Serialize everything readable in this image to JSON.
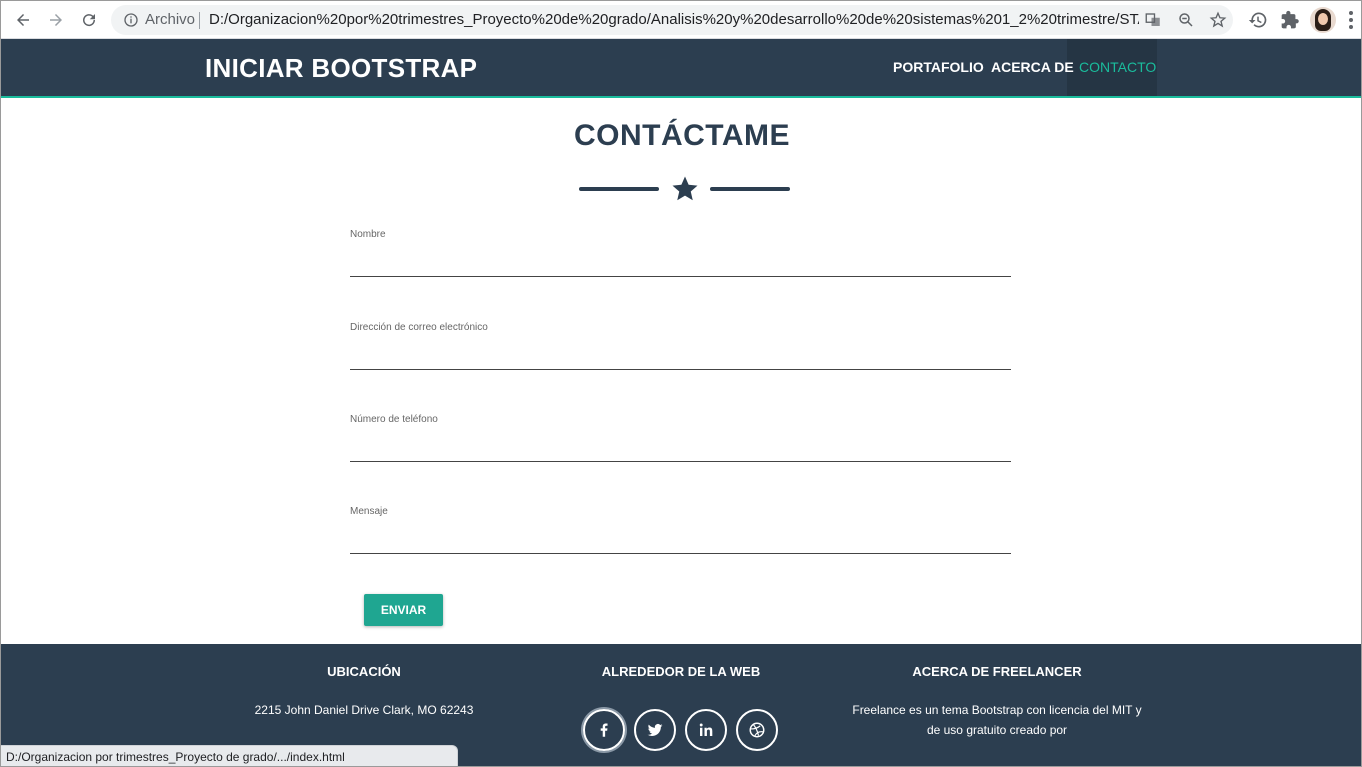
{
  "browser": {
    "origin_label": "Archivo",
    "url": "D:/Organizacion%20por%20trimestres_Proyecto%20de%20grado/Analisis%20y%20desarrollo%20de%20sistemas%201_2%20trimestre/START%20B…",
    "status_url": "D:/Organizacion por trimestres_Proyecto de grado/.../index.html"
  },
  "navbar": {
    "brand": "INICIAR BOOTSTRAP",
    "links": [
      "PORTAFOLIO",
      "ACERCA DE",
      "CONTACTO"
    ],
    "active_color": "#1abc9c"
  },
  "contact": {
    "heading": "CONTÁCTAME",
    "fields": [
      {
        "label": "Nombre",
        "value": ""
      },
      {
        "label": "Dirección de correo electrónico",
        "value": ""
      },
      {
        "label": "Número de teléfono",
        "value": ""
      },
      {
        "label": "Mensaje",
        "value": ""
      }
    ],
    "submit_label": "ENVIAR"
  },
  "footer": {
    "location_title": "UBICACIÓN",
    "location_text": "2215 John Daniel Drive Clark, MO 62243",
    "web_title": "ALREDEDOR DE LA WEB",
    "social_icons": [
      "facebook-icon",
      "twitter-icon",
      "linkedin-icon",
      "dribbble-icon"
    ],
    "about_title": "ACERCA DE FREELANCER",
    "about_text_line1": "Freelance es un tema Bootstrap con licencia del MIT y",
    "about_text_line2": "de uso gratuito creado por"
  },
  "colors": {
    "primary": "#2c3e50",
    "accent": "#1abc9c",
    "button": "#1fa691"
  }
}
